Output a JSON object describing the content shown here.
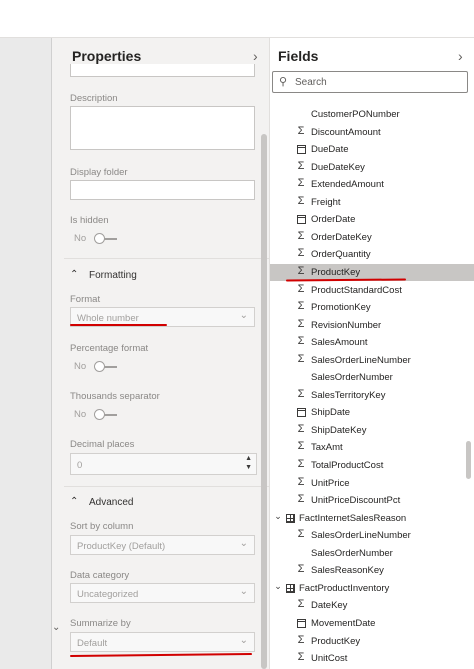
{
  "properties": {
    "title": "Properties",
    "description_label": "Description",
    "display_folder_label": "Display folder",
    "is_hidden_label": "Is hidden",
    "is_hidden_value": "No",
    "formatting_header": "Formatting",
    "format_label": "Format",
    "format_value": "Whole number",
    "percentage_label": "Percentage format",
    "percentage_value": "No",
    "thousands_label": "Thousands separator",
    "thousands_value": "No",
    "decimal_label": "Decimal places",
    "decimal_value": "0",
    "advanced_header": "Advanced",
    "sort_label": "Sort by column",
    "sort_value": "ProductKey (Default)",
    "category_label": "Data category",
    "category_value": "Uncategorized",
    "summarize_label": "Summarize by",
    "summarize_value": "Default"
  },
  "fields": {
    "title": "Fields",
    "search_placeholder": "Search",
    "items": [
      {
        "label": "CustomerPONumber",
        "icon": "none",
        "indent": 2
      },
      {
        "label": "DiscountAmount",
        "icon": "sigma",
        "indent": 2
      },
      {
        "label": "DueDate",
        "icon": "calendar",
        "indent": 2
      },
      {
        "label": "DueDateKey",
        "icon": "sigma",
        "indent": 2
      },
      {
        "label": "ExtendedAmount",
        "icon": "sigma",
        "indent": 2
      },
      {
        "label": "Freight",
        "icon": "sigma",
        "indent": 2
      },
      {
        "label": "OrderDate",
        "icon": "calendar",
        "indent": 2
      },
      {
        "label": "OrderDateKey",
        "icon": "sigma",
        "indent": 2
      },
      {
        "label": "OrderQuantity",
        "icon": "sigma",
        "indent": 2
      },
      {
        "label": "ProductKey",
        "icon": "sigma",
        "indent": 2,
        "selected": true
      },
      {
        "label": "ProductStandardCost",
        "icon": "sigma",
        "indent": 2
      },
      {
        "label": "PromotionKey",
        "icon": "sigma",
        "indent": 2
      },
      {
        "label": "RevisionNumber",
        "icon": "sigma",
        "indent": 2
      },
      {
        "label": "SalesAmount",
        "icon": "sigma",
        "indent": 2
      },
      {
        "label": "SalesOrderLineNumber",
        "icon": "sigma",
        "indent": 2
      },
      {
        "label": "SalesOrderNumber",
        "icon": "none",
        "indent": 2
      },
      {
        "label": "SalesTerritoryKey",
        "icon": "sigma",
        "indent": 2
      },
      {
        "label": "ShipDate",
        "icon": "calendar",
        "indent": 2
      },
      {
        "label": "ShipDateKey",
        "icon": "sigma",
        "indent": 2
      },
      {
        "label": "TaxAmt",
        "icon": "sigma",
        "indent": 2
      },
      {
        "label": "TotalProductCost",
        "icon": "sigma",
        "indent": 2
      },
      {
        "label": "UnitPrice",
        "icon": "sigma",
        "indent": 2
      },
      {
        "label": "UnitPriceDiscountPct",
        "icon": "sigma",
        "indent": 2
      },
      {
        "label": "FactInternetSalesReason",
        "icon": "table",
        "indent": 1
      },
      {
        "label": "SalesOrderLineNumber",
        "icon": "sigma",
        "indent": 2
      },
      {
        "label": "SalesOrderNumber",
        "icon": "none",
        "indent": 2
      },
      {
        "label": "SalesReasonKey",
        "icon": "sigma",
        "indent": 2
      },
      {
        "label": "FactProductInventory",
        "icon": "table",
        "indent": 1
      },
      {
        "label": "DateKey",
        "icon": "sigma",
        "indent": 2
      },
      {
        "label": "MovementDate",
        "icon": "calendar",
        "indent": 2
      },
      {
        "label": "ProductKey",
        "icon": "sigma",
        "indent": 2
      },
      {
        "label": "UnitCost",
        "icon": "sigma",
        "indent": 2
      }
    ]
  }
}
